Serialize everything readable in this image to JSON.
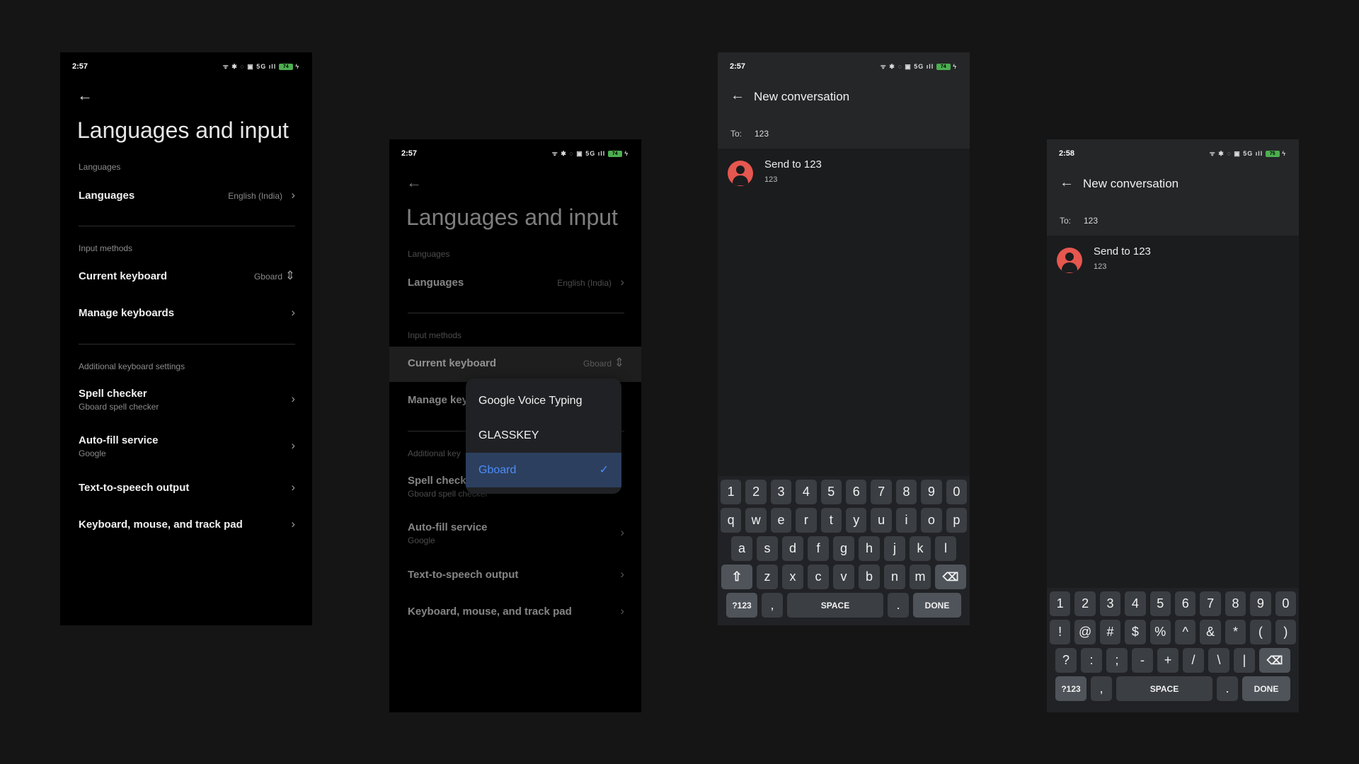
{
  "screen1": {
    "status": {
      "time": "2:57",
      "icons_text": "ᯤ ✱ ◌ ▣ 5G ıll",
      "battery": "74"
    },
    "title": "Languages and input",
    "sections": {
      "languages": "Languages",
      "input": "Input methods",
      "additional": "Additional keyboard settings"
    },
    "rows": {
      "languages": {
        "label": "Languages",
        "value": "English (India)"
      },
      "current_keyboard": {
        "label": "Current keyboard",
        "value": "Gboard"
      },
      "manage": {
        "label": "Manage keyboards"
      },
      "spell": {
        "label": "Spell checker",
        "sub": "Gboard spell checker"
      },
      "autofill": {
        "label": "Auto-fill service",
        "sub": "Google"
      },
      "tts": {
        "label": "Text-to-speech output"
      },
      "kmt": {
        "label": "Keyboard, mouse, and track pad"
      }
    }
  },
  "screen2": {
    "status": {
      "time": "2:57",
      "icons_text": "ᯤ ✱ ◌ ▣ 5G ıll",
      "battery": "74"
    },
    "title": "Languages and input",
    "sections": {
      "languages": "Languages",
      "input": "Input methods",
      "additional": "Additional key"
    },
    "rows": {
      "languages": {
        "label": "Languages",
        "value": "English (India)"
      },
      "current_keyboard": {
        "label": "Current keyboard",
        "value": "Gboard"
      },
      "manage": {
        "label": "Manage key"
      },
      "spell": {
        "label": "Spell checke",
        "sub": "Gboard spell checker"
      },
      "autofill": {
        "label": "Auto-fill service",
        "sub": "Google"
      },
      "tts": {
        "label": "Text-to-speech output"
      },
      "kmt": {
        "label": "Keyboard, mouse, and track pad"
      }
    },
    "dropdown": {
      "options": [
        "Google Voice Typing",
        "GLASSKEY",
        "Gboard"
      ],
      "selected": "Gboard",
      "check": "✓"
    }
  },
  "screen3": {
    "status": {
      "time": "2:57",
      "icons_text": "ᯤ ✱ ◌ ▣ 5G ıll",
      "battery": "74"
    },
    "title": "New conversation",
    "to_label": "To:",
    "to_value": "123",
    "contact_name": "Send to 123",
    "contact_number": "123",
    "keyboard": {
      "row1": [
        "1",
        "2",
        "3",
        "4",
        "5",
        "6",
        "7",
        "8",
        "9",
        "0"
      ],
      "row2": [
        "q",
        "w",
        "e",
        "r",
        "t",
        "y",
        "u",
        "i",
        "o",
        "p"
      ],
      "row3": [
        "a",
        "s",
        "d",
        "f",
        "g",
        "h",
        "j",
        "k",
        "l"
      ],
      "row4_letters": [
        "z",
        "x",
        "c",
        "v",
        "b",
        "n",
        "m"
      ],
      "shift": "⇧",
      "backspace": "⌫",
      "symbols": "?123",
      "comma": ",",
      "space": "SPACE",
      "period": ".",
      "done": "DONE"
    }
  },
  "screen4": {
    "status": {
      "time": "2:58",
      "icons_text": "ᯤ ✱ ◌ ▣ 5G ıll",
      "battery": "75"
    },
    "title": "New conversation",
    "to_label": "To:",
    "to_value": "123",
    "contact_name": "Send to 123",
    "contact_number": "123",
    "keyboard": {
      "row1": [
        "1",
        "2",
        "3",
        "4",
        "5",
        "6",
        "7",
        "8",
        "9",
        "0"
      ],
      "row2": [
        "!",
        "@",
        "#",
        "$",
        "%",
        "^",
        "&",
        "*",
        "(",
        ")"
      ],
      "row3": [
        "?",
        ":",
        ";",
        "-",
        "+",
        "/",
        "\\",
        "|"
      ],
      "backspace": "⌫",
      "symbols": "?123",
      "comma": ",",
      "space": "SPACE",
      "period": ".",
      "done": "DONE"
    }
  }
}
